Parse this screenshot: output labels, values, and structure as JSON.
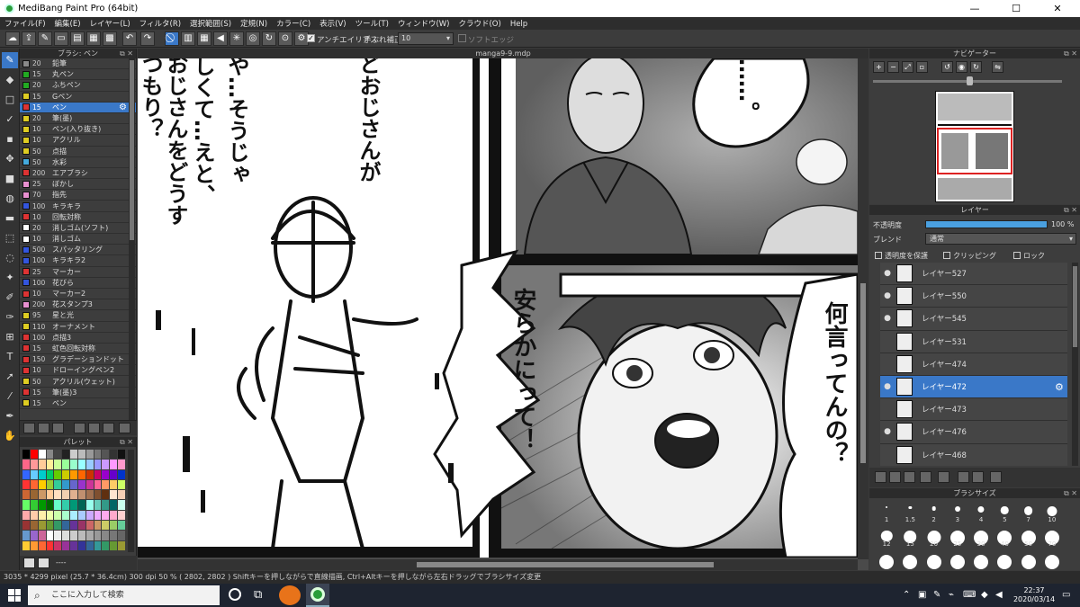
{
  "window": {
    "title": "MediBang Paint Pro (64bit)",
    "minimize": "—",
    "maximize": "☐",
    "close": "✕"
  },
  "menu": [
    "ファイル(F)",
    "編集(E)",
    "レイヤー(L)",
    "フィルタ(R)",
    "選択範囲(S)",
    "定規(N)",
    "カラー(C)",
    "表示(V)",
    "ツール(T)",
    "ウィンドウ(W)",
    "クラウド(O)",
    "Help"
  ],
  "toolbar": {
    "antialias_label": "アンチエイリアス",
    "stabilizer_label": "手ぶれ補正",
    "stabilizer_value": "10",
    "softedge_label": "ソフトエッジ"
  },
  "brush_panel": {
    "title": "ブラシ: ペン",
    "items": [
      {
        "size": "20",
        "name": "鉛筆",
        "color": "#8a8a8a"
      },
      {
        "size": "15",
        "name": "丸ペン",
        "color": "#22aa22"
      },
      {
        "size": "20",
        "name": "ふちペン",
        "color": "#22aa22"
      },
      {
        "size": "15",
        "name": "Gペン",
        "color": "#ddcc22"
      },
      {
        "size": "15",
        "name": "ペン",
        "color": "#dd3333"
      },
      {
        "size": "20",
        "name": "筆(墨)",
        "color": "#ddcc22"
      },
      {
        "size": "10",
        "name": "ペン(入り抜き)",
        "color": "#ddcc22"
      },
      {
        "size": "10",
        "name": "アクリル",
        "color": "#ddcc22"
      },
      {
        "size": "50",
        "name": "点描",
        "color": "#ddcc22"
      },
      {
        "size": "50",
        "name": "水彩",
        "color": "#44aadd"
      },
      {
        "size": "200",
        "name": "エアブラシ",
        "color": "#dd3333"
      },
      {
        "size": "25",
        "name": "ぼかし",
        "color": "#e890d0"
      },
      {
        "size": "70",
        "name": "指先",
        "color": "#e890d0"
      },
      {
        "size": "100",
        "name": "キラキラ",
        "color": "#3355dd"
      },
      {
        "size": "10",
        "name": "回転対称",
        "color": "#dd3333"
      },
      {
        "size": "20",
        "name": "消しゴム(ソフト)",
        "color": "#ffffff"
      },
      {
        "size": "10",
        "name": "消しゴム",
        "color": "#ffffff"
      },
      {
        "size": "500",
        "name": "スパッタリング",
        "color": "#3355dd"
      },
      {
        "size": "100",
        "name": "キラキラ2",
        "color": "#3355dd"
      },
      {
        "size": "25",
        "name": "マーカー",
        "color": "#dd3333"
      },
      {
        "size": "100",
        "name": "花びら",
        "color": "#3355dd"
      },
      {
        "size": "10",
        "name": "マーカー2",
        "color": "#dd3333"
      },
      {
        "size": "200",
        "name": "花スタンプ3",
        "color": "#e890d0"
      },
      {
        "size": "95",
        "name": "星と光",
        "color": "#ddcc22"
      },
      {
        "size": "110",
        "name": "オーナメント",
        "color": "#ddcc22"
      },
      {
        "size": "100",
        "name": "点描3",
        "color": "#dd3333"
      },
      {
        "size": "15",
        "name": "虹色回転対称",
        "color": "#dd3333"
      },
      {
        "size": "150",
        "name": "グラデーションドット",
        "color": "#dd3333"
      },
      {
        "size": "10",
        "name": "ドローイングペン2",
        "color": "#dd3333"
      },
      {
        "size": "50",
        "name": "アクリル(ウェット)",
        "color": "#ddcc22"
      },
      {
        "size": "15",
        "name": "筆(墨)3",
        "color": "#dd3333"
      },
      {
        "size": "15",
        "name": "ペン",
        "color": "#ddcc22"
      }
    ]
  },
  "palette": {
    "title": "パレット",
    "footer": "----",
    "colors": [
      "#000000",
      "#ff0000",
      "#ffffff",
      "#888888",
      "#444444",
      "#222222",
      "#cccccc",
      "#bbbbbb",
      "#999999",
      "#777777",
      "#555555",
      "#333333",
      "#111111",
      "#ff6688",
      "#ff9999",
      "#ffcc99",
      "#ffee99",
      "#ccff99",
      "#99ff99",
      "#99ffcc",
      "#99ffff",
      "#99ccff",
      "#9999ff",
      "#cc99ff",
      "#ff99ff",
      "#ff99cc",
      "#3366ff",
      "#66ccff",
      "#00cccc",
      "#00cc66",
      "#66cc00",
      "#cccc00",
      "#ff9900",
      "#ff6600",
      "#cc3300",
      "#cc0066",
      "#9900cc",
      "#6600cc",
      "#0033cc",
      "#ff3333",
      "#ff6633",
      "#ffcc00",
      "#99cc33",
      "#33cc99",
      "#3399cc",
      "#6666cc",
      "#9933cc",
      "#cc3399",
      "#ff6699",
      "#ff9966",
      "#ffcc66",
      "#ccff66",
      "#cc6633",
      "#996633",
      "#cc9966",
      "#ffcc99",
      "#ffe0c0",
      "#f0d0b0",
      "#e0b090",
      "#c09070",
      "#a07050",
      "#805030",
      "#603010",
      "#ffe4d0",
      "#f5cfb5",
      "#66ff66",
      "#33cc33",
      "#009900",
      "#006600",
      "#66ffcc",
      "#33ccaa",
      "#009977",
      "#006655",
      "#99ffee",
      "#66ccbb",
      "#339988",
      "#006666",
      "#ccffee",
      "#ffaaaa",
      "#ffccaa",
      "#ffeeaa",
      "#eeffaa",
      "#ccffaa",
      "#aaffcc",
      "#aaeeff",
      "#aaccff",
      "#ccaaff",
      "#eeaaff",
      "#ffaaee",
      "#ffaacc",
      "#ffd0d0",
      "#993333",
      "#996633",
      "#999933",
      "#669933",
      "#339966",
      "#336699",
      "#663399",
      "#993366",
      "#cc6666",
      "#cc9966",
      "#cccc66",
      "#99cc66",
      "#66cc99",
      "#6699cc",
      "#9966cc",
      "#cc6699",
      "#ffffff",
      "#eeeeee",
      "#dddddd",
      "#cccccc",
      "#bbbbbb",
      "#aaaaaa",
      "#999999",
      "#888888",
      "#777777",
      "#666666",
      "#ffcc33",
      "#ff9933",
      "#ff6633",
      "#ff3333",
      "#cc3366",
      "#993399",
      "#663399",
      "#333399",
      "#336699",
      "#339999",
      "#339966",
      "#669933",
      "#999933"
    ]
  },
  "document": {
    "tab": "manga9-9.mdp"
  },
  "comic_text": {
    "p1_col1": "つもり？",
    "p1_col2": "おじさんをどうす",
    "p1_col3": "しくて…えと、",
    "p1_col4": "や…そうじゃ",
    "p1_col5": "どおじさんが",
    "p2": "……。",
    "p3_left": "安らかにって！",
    "p3_right": "何言ってんの？"
  },
  "navigator": {
    "title": "ナビゲーター"
  },
  "layers": {
    "title": "レイヤー",
    "opacity_label": "不透明度",
    "opacity_value": "100 %",
    "opacity_fraction": 1.0,
    "blend_label": "ブレンド",
    "blend_value": "通常",
    "protect_label": "透明度を保護",
    "clip_label": "クリッピング",
    "lock_label": "ロック",
    "items": [
      {
        "name": "レイヤー527",
        "visible": true
      },
      {
        "name": "レイヤー550",
        "visible": true
      },
      {
        "name": "レイヤー545",
        "visible": true
      },
      {
        "name": "レイヤー531",
        "visible": false
      },
      {
        "name": "レイヤー474",
        "visible": false
      },
      {
        "name": "レイヤー472",
        "visible": true,
        "selected": true
      },
      {
        "name": "レイヤー473",
        "visible": false
      },
      {
        "name": "レイヤー476",
        "visible": true
      },
      {
        "name": "レイヤー468",
        "visible": false
      }
    ]
  },
  "brush_size": {
    "title": "ブラシサイズ",
    "sizes": [
      "1",
      "1.5",
      "2",
      "3",
      "4",
      "5",
      "7",
      "10",
      "12",
      "15",
      "20",
      "25",
      "30",
      "40",
      "50",
      "70",
      "",
      "",
      "",
      "",
      "",
      "",
      "",
      ""
    ]
  },
  "status": {
    "text": "3035 * 4299 pixel   (25.7 * 36.4cm)   300 dpi   50 %   ( 2802, 2802 )   Shiftキーを押しながらで直線描画, Ctrl+Altキーを押しながら左右ドラッグでブラシサイズ変更"
  },
  "taskbar": {
    "search_placeholder": "ここに入力して検索",
    "time": "22:37",
    "date": "2020/03/14"
  }
}
